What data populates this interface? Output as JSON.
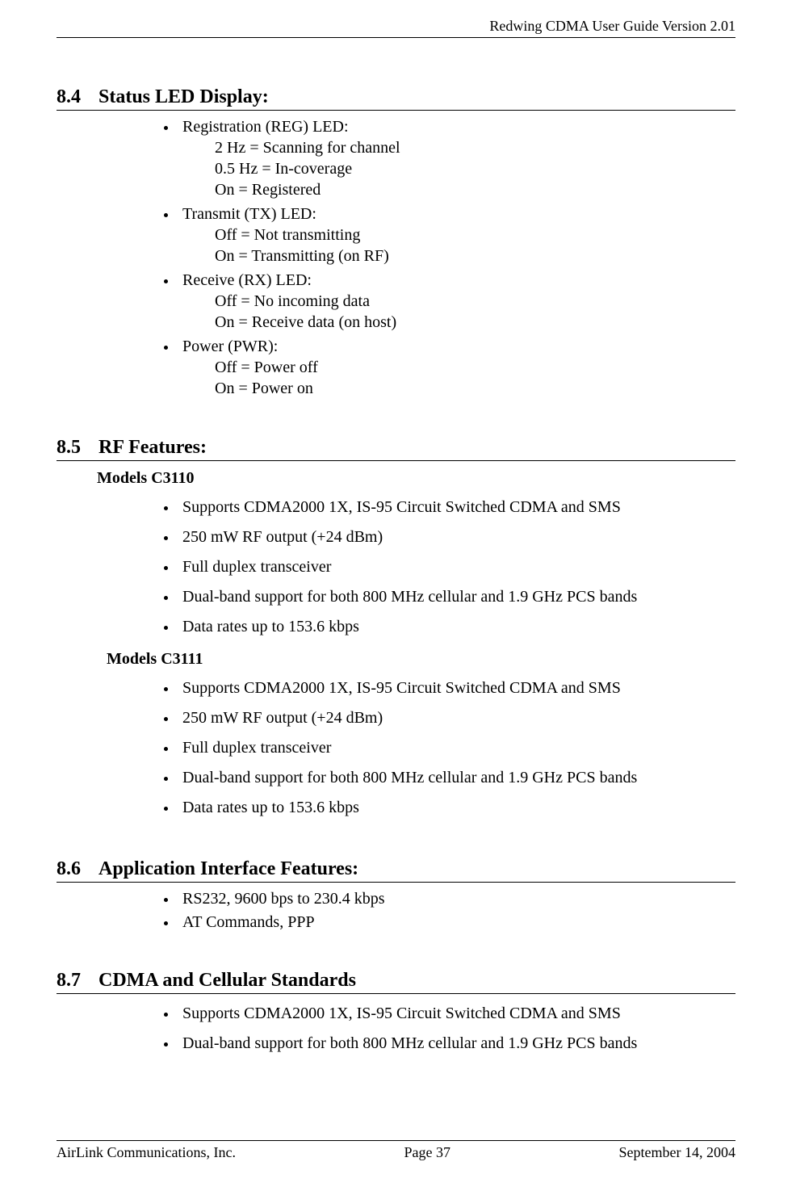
{
  "header": {
    "right": "Redwing CDMA User Guide Version 2.01"
  },
  "sections": {
    "s84": {
      "num": "8.4",
      "title": "Status LED Display:",
      "items": {
        "reg": {
          "label": "Registration (REG) LED:",
          "l1": "2 Hz = Scanning for channel",
          "l2": "0.5 Hz = In-coverage",
          "l3": "On = Registered"
        },
        "tx": {
          "label": "Transmit (TX) LED:",
          "l1": "Off = Not transmitting",
          "l2": "On = Transmitting (on RF)"
        },
        "rx": {
          "label": "Receive (RX) LED:",
          "l1": "Off = No incoming data",
          "l2": "On = Receive data (on host)"
        },
        "pwr": {
          "label": "Power (PWR):",
          "l1": "Off = Power off",
          "l2": "On = Power on"
        }
      }
    },
    "s85": {
      "num": "8.5",
      "title": "RF Features:",
      "model_a": {
        "head": "Models C3110",
        "i1": "Supports CDMA2000 1X, IS-95 Circuit Switched CDMA and SMS",
        "i2": "250 mW RF output (+24 dBm)",
        "i3": "Full duplex transceiver",
        "i4": "Dual-band support for both 800 MHz cellular and 1.9 GHz PCS bands",
        "i5": "Data rates up to 153.6 kbps"
      },
      "model_b": {
        "head": "Models C3111",
        "i1": "Supports CDMA2000 1X, IS-95 Circuit Switched CDMA and SMS",
        "i2": "250 mW RF output (+24 dBm)",
        "i3": "Full duplex transceiver",
        "i4": "Dual-band support for both 800 MHz cellular and 1.9 GHz PCS bands",
        "i5": "Data rates up to 153.6 kbps"
      }
    },
    "s86": {
      "num": "8.6",
      "title": "Application Interface Features:",
      "i1": "RS232, 9600 bps to 230.4 kbps",
      "i2": "AT Commands, PPP"
    },
    "s87": {
      "num": "8.7",
      "title": "CDMA and Cellular Standards",
      "i1": "Supports CDMA2000 1X, IS-95 Circuit Switched CDMA and SMS",
      "i2": "Dual-band support for both 800 MHz cellular and 1.9 GHz PCS bands"
    }
  },
  "footer": {
    "left": "AirLink Communications, Inc.",
    "center": "Page 37",
    "right": "September 14, 2004"
  }
}
